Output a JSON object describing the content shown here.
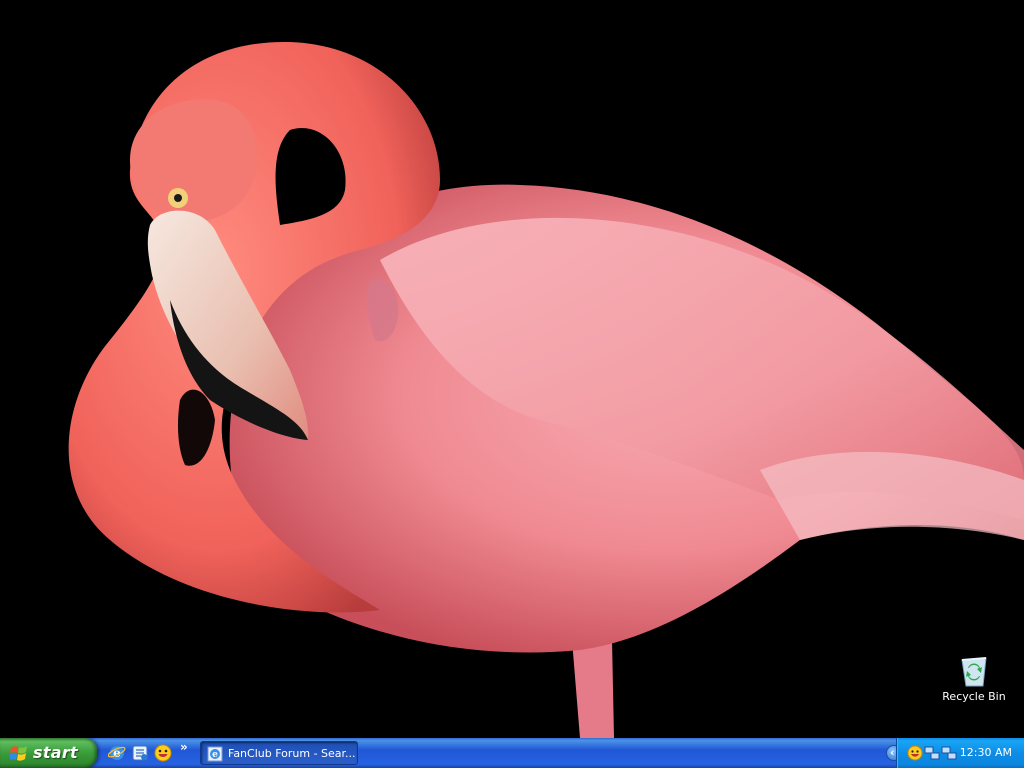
{
  "desktop": {
    "wallpaper_icon": "flamingo-wallpaper",
    "icons": [
      {
        "label": "Recycle Bin",
        "icon": "recycle-bin-icon"
      }
    ]
  },
  "taskbar": {
    "start_label": "start",
    "quick_launch": [
      {
        "icon": "internet-explorer-icon"
      },
      {
        "icon": "outlook-express-icon"
      },
      {
        "icon": "messenger-smiley-icon"
      }
    ],
    "quick_launch_more": "»",
    "tasks": [
      {
        "label": "FanClub Forum - Sear...",
        "icon": "internet-explorer-icon"
      }
    ],
    "tray": {
      "expand_label": "‹",
      "icons": [
        "messenger-smiley-icon",
        "network-connection-icon",
        "network-connection-icon"
      ],
      "clock": "12:30 AM"
    }
  },
  "colors": {
    "taskbar_blue": "#2157d7",
    "start_green": "#3a9c3a",
    "tray_blue": "#0d8de6",
    "flamingo_pink": "#f07a7e",
    "desktop_black": "#000000"
  }
}
